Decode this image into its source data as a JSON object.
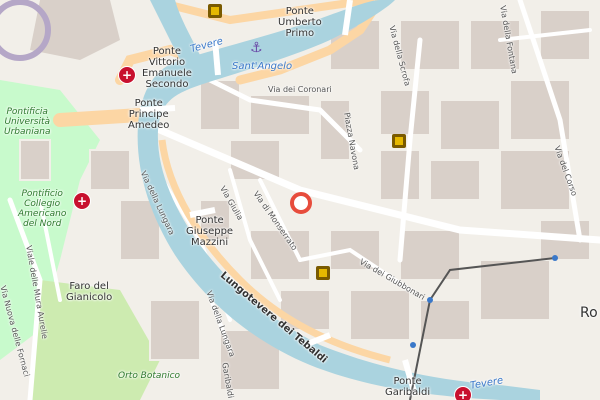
{
  "map": {
    "labels": {
      "ponte_umberto_primo": "Ponte\nUmberto\nPrimo",
      "ponte_vittorio": "Ponte\nVittorio\nEmanuele\nSecondo",
      "ponte_principe": "Ponte\nPrincipe\nAmedeo",
      "ponte_mazzini": "Ponte\nGiuseppe\nMazzini",
      "ponte_garibaldi": "Ponte\nGaribaldi",
      "sant_angelo": "Sant'Angelo",
      "tevere_top": "Tevere",
      "tevere_bottom": "Tevere",
      "lungotevere": "Lungotevere dei Tebaldi",
      "via_coronari": "Via dei Coronari",
      "piazza_navona": "Piazza Navona",
      "via_scrofa": "Via della Scrofa",
      "via_corso": "Via del Corso",
      "via_giulia": "Via Giulia",
      "via_monserrato": "Via di Monserrato",
      "via_lungara": "Via della Lungara",
      "via_lungara_2": "Via della Lungara",
      "via_giubbonari": "Via dei Giubbonari",
      "pontificia": "Pontificia\nUniversità\nUrbaniana",
      "pontificio": "Pontificio\nCollegio\nAmericano\ndel Nord",
      "faro": "Faro del\nGianicolo",
      "orto": "Orto Botanico",
      "mura_aureli": "Viale delle Mura Aurelie",
      "via_nuova_fornaci": "Via Nuova delle Fornaci",
      "garibaldi_street": "Garibaldi",
      "roma_edge": "Ro",
      "via_fontana": "Via della Fontana"
    }
  },
  "colors": {
    "river": "#aad3df",
    "main_road": "#fcd6a4",
    "block": "#d9d0c9",
    "park": "#c8facc",
    "marker": "#e74c3c"
  }
}
